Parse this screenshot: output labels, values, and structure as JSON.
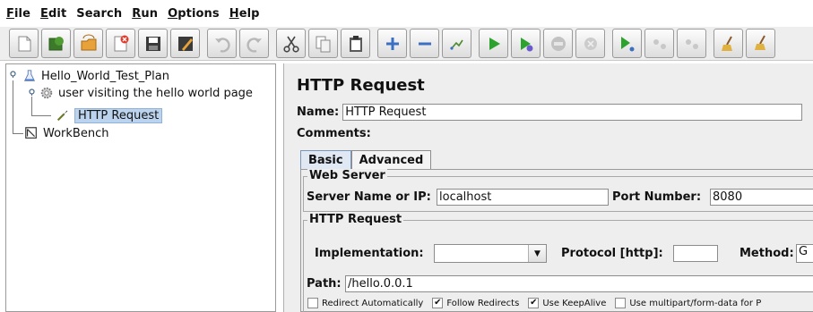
{
  "menubar": {
    "items": [
      {
        "mnemonic": "F",
        "rest": "ile"
      },
      {
        "mnemonic": "E",
        "rest": "dit"
      },
      {
        "mnemonic": "",
        "rest": "Search"
      },
      {
        "mnemonic": "R",
        "rest": "un"
      },
      {
        "mnemonic": "O",
        "rest": "ptions"
      },
      {
        "mnemonic": "H",
        "rest": "elp"
      }
    ]
  },
  "toolbar": {
    "icons": [
      "new-icon",
      "templates-icon",
      "open-icon",
      "close-icon",
      "save-icon",
      "save-as-icon",
      "undo-icon",
      "redo-icon",
      "cut-icon",
      "copy-icon",
      "paste-icon",
      "expand-icon",
      "collapse-icon",
      "toggle-icon",
      "start-icon",
      "start-no-pause-icon",
      "stop-icon",
      "shutdown-icon",
      "remote-start-icon",
      "remote-stop-icon",
      "remote-shutdown-icon",
      "clear-icon",
      "clear-all-icon"
    ]
  },
  "tree": {
    "test_plan": "Hello_World_Test_Plan",
    "thread_group": "user visiting the hello world page",
    "sampler": "HTTP Request",
    "workbench": "WorkBench"
  },
  "panel": {
    "title": "HTTP Request",
    "name_label": "Name:",
    "name_value": "HTTP Request",
    "comments_label": "Comments:",
    "tabs": {
      "basic": "Basic",
      "advanced": "Advanced"
    },
    "web_server": {
      "legend": "Web Server",
      "server_label": "Server Name or IP:",
      "server_value": "localhost",
      "port_label": "Port Number:",
      "port_value": "8080"
    },
    "http_request": {
      "legend": "HTTP Request",
      "implementation_label": "Implementation:",
      "implementation_value": "",
      "protocol_label": "Protocol [http]:",
      "protocol_value": "",
      "method_label": "Method:",
      "method_value": "G",
      "path_label": "Path:",
      "path_value": "/hello.0.0.1"
    },
    "checkboxes": [
      {
        "label": "Redirect Automatically",
        "checked": false
      },
      {
        "label": "Follow Redirects",
        "checked": true
      },
      {
        "label": "Use KeepAlive",
        "checked": true
      },
      {
        "label": "Use multipart/form-data for P",
        "checked": false
      }
    ]
  }
}
